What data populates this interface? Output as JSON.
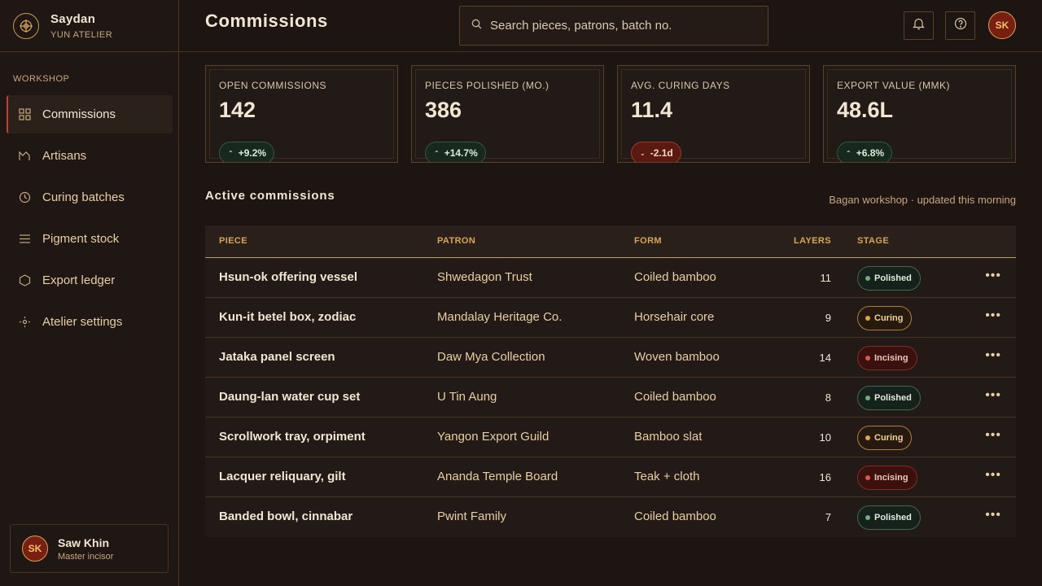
{
  "brand": {
    "name": "Saydan",
    "subtitle": "YUN ATELIER"
  },
  "sidebar": {
    "section": "WORKSHOP",
    "items": [
      {
        "label": "Commissions",
        "icon": "grid-icon",
        "active": true
      },
      {
        "label": "Artisans",
        "icon": "artisan-icon"
      },
      {
        "label": "Curing batches",
        "icon": "clock-icon"
      },
      {
        "label": "Pigment stock",
        "icon": "list-icon"
      },
      {
        "label": "Export ledger",
        "icon": "hexagon-icon"
      },
      {
        "label": "Atelier settings",
        "icon": "settings-icon"
      }
    ]
  },
  "user": {
    "initials": "SK",
    "name": "Saw Khin",
    "role": "Master incisor"
  },
  "header": {
    "title": "Commissions",
    "search_placeholder": "Search pieces, patrons, batch no.",
    "avatar_initials": "SK"
  },
  "kpis": [
    {
      "label": "OPEN COMMISSIONS",
      "value": "142",
      "delta": "+9.2%",
      "trend": "up"
    },
    {
      "label": "PIECES POLISHED (MO.)",
      "value": "386",
      "delta": "+14.7%",
      "trend": "up"
    },
    {
      "label": "AVG. CURING DAYS",
      "value": "11.4",
      "delta": "-2.1d",
      "trend": "down"
    },
    {
      "label": "EXPORT VALUE (MMK)",
      "value": "48.6L",
      "delta": "+6.8%",
      "trend": "up"
    }
  ],
  "section": {
    "title": "Active commissions",
    "meta": "Bagan workshop · updated this morning"
  },
  "table": {
    "headers": {
      "piece": "PIECE",
      "patron": "PATRON",
      "form": "FORM",
      "layers": "LAYERS",
      "stage": "STAGE"
    },
    "rows": [
      {
        "piece": "Hsun-ok offering vessel",
        "patron": "Shwedagon Trust",
        "form": "Coiled bamboo",
        "layers": "11",
        "stage": "Polished"
      },
      {
        "piece": "Kun-it betel box, zodiac",
        "patron": "Mandalay Heritage Co.",
        "form": "Horsehair core",
        "layers": "9",
        "stage": "Curing"
      },
      {
        "piece": "Jataka panel screen",
        "patron": "Daw Mya Collection",
        "form": "Woven bamboo",
        "layers": "14",
        "stage": "Incising"
      },
      {
        "piece": "Daung-lan water cup set",
        "patron": "U Tin Aung",
        "form": "Coiled bamboo",
        "layers": "8",
        "stage": "Polished"
      },
      {
        "piece": "Scrollwork tray, orpiment",
        "patron": "Yangon Export Guild",
        "form": "Bamboo slat",
        "layers": "10",
        "stage": "Curing"
      },
      {
        "piece": "Lacquer reliquary, gilt",
        "patron": "Ananda Temple Board",
        "form": "Teak + cloth",
        "layers": "16",
        "stage": "Incising"
      },
      {
        "piece": "Banded bowl, cinnabar",
        "patron": "Pwint Family",
        "form": "Coiled bamboo",
        "layers": "7",
        "stage": "Polished"
      }
    ]
  },
  "colors": {
    "accent": "#d9a54e",
    "active_marker": "#c7402f",
    "background": "#1c1512"
  }
}
